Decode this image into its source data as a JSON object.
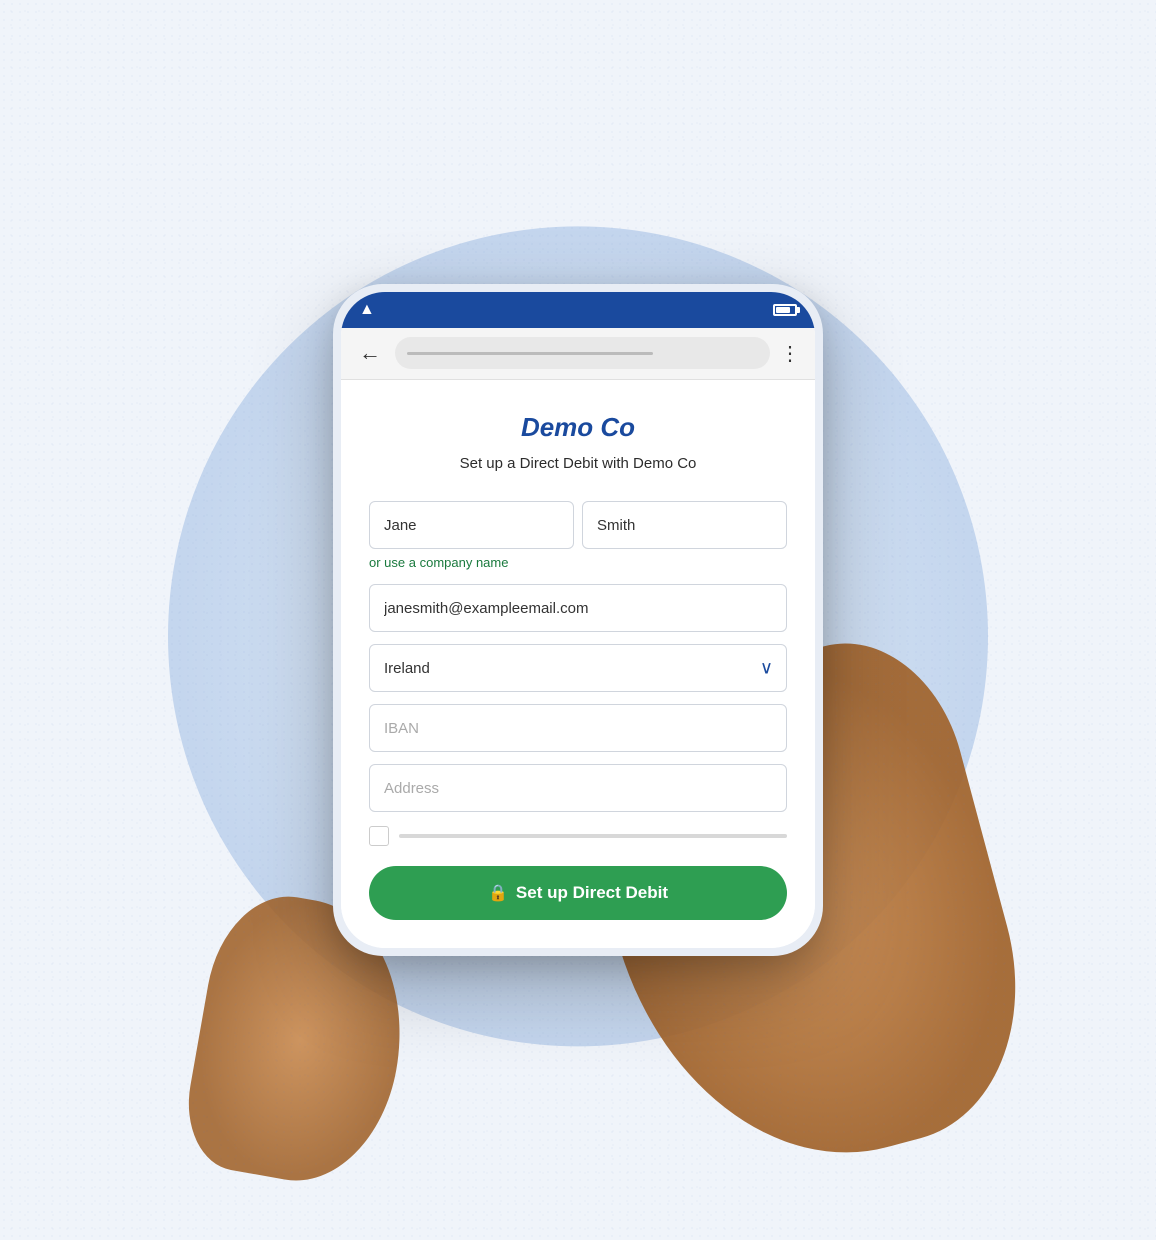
{
  "background": {
    "circle_color": "#cdd9ef"
  },
  "status_bar": {
    "signal": "▲",
    "battery": ""
  },
  "nav": {
    "back_icon": "←",
    "menu_icon": "⋮"
  },
  "form": {
    "company_name": "Demo Co",
    "subtitle": "Set up a Direct Debit with Demo Co",
    "first_name_placeholder": "Jane",
    "last_name_placeholder": "Smith",
    "company_link_label": "or use a company name",
    "email_value": "janesmith@exampleemail.com",
    "email_placeholder": "janesmith@exampleemail.com",
    "country_value": "Ireland",
    "iban_placeholder": "IBAN",
    "address_placeholder": "Address",
    "submit_label": "Set up Direct Debit",
    "lock_icon": "🔒"
  }
}
